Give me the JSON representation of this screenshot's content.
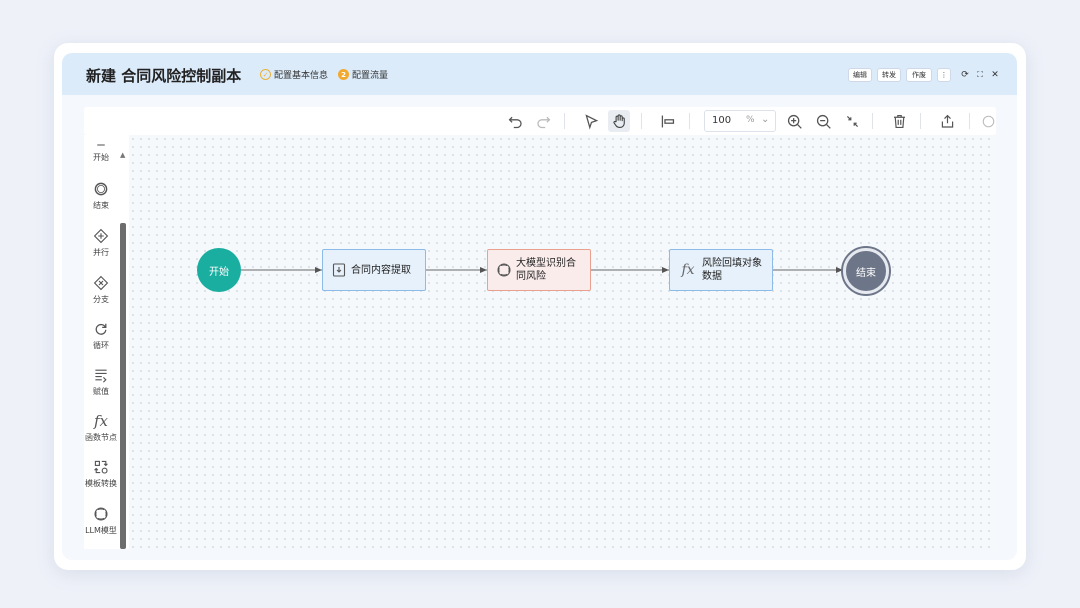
{
  "window": {
    "title": "新建  合同风险控制副本",
    "steps": [
      {
        "label": "配置基本信息",
        "mark": "✓"
      },
      {
        "label": "配置流量",
        "mark": "2"
      }
    ],
    "buttons": {
      "edit": "编辑",
      "forward": "转发",
      "void": "作废"
    },
    "icons": {
      "more": "⋮",
      "refresh": "⟳",
      "fullscreen": "⛶",
      "close": "✕"
    }
  },
  "toolbar": {
    "zoom_value": "100",
    "zoom_unit": "%",
    "icons": [
      "undo-icon",
      "redo-icon",
      "select-icon",
      "pan-hand-icon",
      "align-icon",
      "zoom-in-icon",
      "zoom-out-icon",
      "fit-screen-icon",
      "delete-icon",
      "export-icon",
      "more-icon"
    ]
  },
  "sidebar": {
    "items": [
      {
        "label": "开始",
        "icon": "start-icon"
      },
      {
        "label": "结束",
        "icon": "end-icon"
      },
      {
        "label": "并行",
        "icon": "parallel-icon"
      },
      {
        "label": "分支",
        "icon": "branch-icon"
      },
      {
        "label": "循环",
        "icon": "loop-icon"
      },
      {
        "label": "赋值",
        "icon": "assign-icon"
      },
      {
        "label": "函数节点",
        "icon": "function-icon"
      },
      {
        "label": "模板转换",
        "icon": "template-convert-icon"
      },
      {
        "label": "LLM模型",
        "icon": "llm-icon"
      }
    ]
  },
  "flow": {
    "nodes": [
      {
        "id": "start",
        "label": "开始"
      },
      {
        "id": "extract",
        "label": "合同内容提取",
        "icon": "extract-icon"
      },
      {
        "id": "llm",
        "label": "大模型识别合同风险",
        "icon": "llm-icon"
      },
      {
        "id": "backfill",
        "label": "风险回填对象数据",
        "icon": "function-icon"
      },
      {
        "id": "end",
        "label": "结束"
      }
    ],
    "colors": {
      "start": "#1aaea0",
      "end": "#6d7688",
      "rect_border": "#8bbbe6",
      "llm_border": "#eaa08f"
    }
  }
}
